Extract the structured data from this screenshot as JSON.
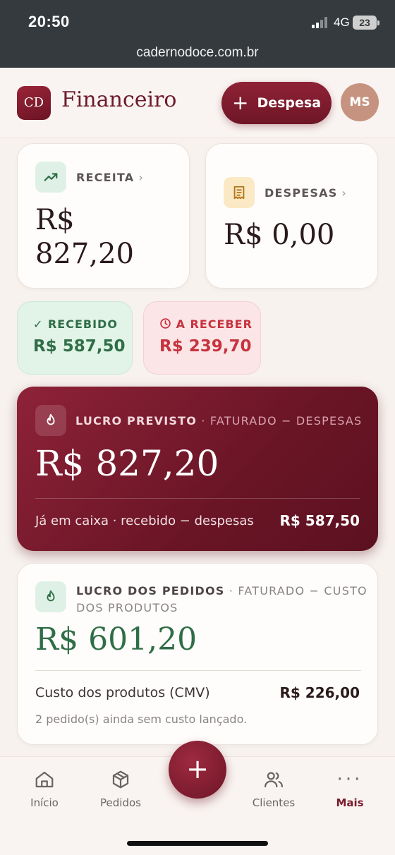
{
  "status": {
    "time": "20:50",
    "network": "4G",
    "battery": "23"
  },
  "browser": {
    "url": "cadernodoce.com.br"
  },
  "header": {
    "logo": "CD",
    "title": "Financeiro",
    "add_expense_label": "Despesa",
    "avatar_initials": "MS"
  },
  "receita": {
    "label": "RECEITA",
    "value_line1": "R$",
    "value_line2": "827,20"
  },
  "despesas": {
    "label": "DESPESAS",
    "value": "R$ 0,00"
  },
  "recebido": {
    "label": "RECEBIDO",
    "value": "R$ 587,50"
  },
  "a_receber": {
    "label": "A RECEBER",
    "value": "R$ 239,70"
  },
  "lucro_previsto": {
    "label": "LUCRO PREVISTO",
    "formula": "· FATURADO − DESPESAS",
    "value": "R$ 827,20",
    "cash_label": "Já em caixa · recebido − despesas",
    "cash_value": "R$ 587,50"
  },
  "lucro_pedidos": {
    "label": "LUCRO DOS PEDIDOS",
    "formula_line1": "· FATURADO − CUSTO",
    "formula_line2": "DOS PRODUTOS",
    "value": "R$ 601,20",
    "cmv_label": "Custo dos produtos (CMV)",
    "cmv_value": "R$ 226,00",
    "note": "2 pedido(s) ainda sem custo lançado."
  },
  "nav": {
    "inicio": "Início",
    "pedidos": "Pedidos",
    "clientes": "Clientes",
    "mais": "Mais"
  },
  "colors": {
    "brand": "#7a1b2e",
    "positive": "#2f6e47",
    "negative": "#c6333f"
  }
}
